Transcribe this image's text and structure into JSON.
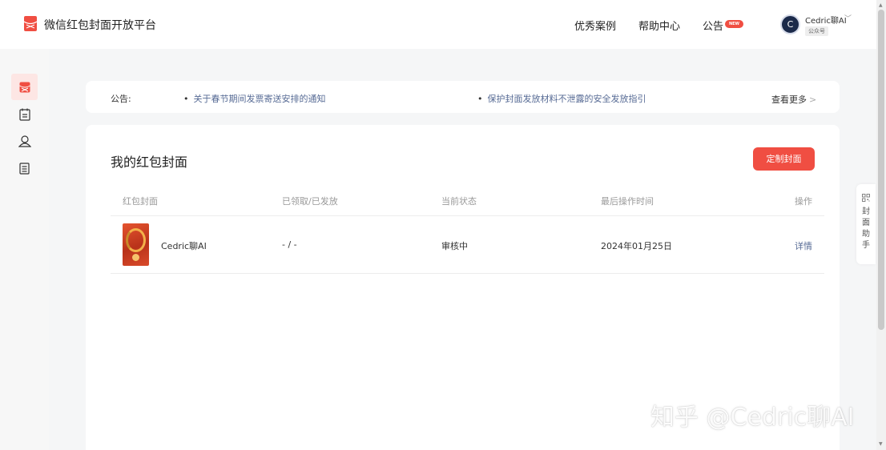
{
  "app": {
    "title": "微信红包封面开放平台"
  },
  "topnav": {
    "items": [
      {
        "label": "优秀案例"
      },
      {
        "label": "帮助中心"
      },
      {
        "label": "公告"
      }
    ],
    "new_badge": "NEW"
  },
  "user": {
    "name": "Cedric聊AI",
    "avatar_letter": "C",
    "account_type": "公众号"
  },
  "sidebar": {
    "items": [
      {
        "icon": "red-packet-icon",
        "active": true
      },
      {
        "icon": "clipboard-icon",
        "active": false
      },
      {
        "icon": "user-icon",
        "active": false
      },
      {
        "icon": "document-icon",
        "active": false
      }
    ]
  },
  "notice": {
    "label": "公告:",
    "links": [
      "关于春节期间发票寄送安排的通知",
      "保护封面发放材料不泄露的安全发放指引"
    ],
    "more": "查看更多"
  },
  "covers": {
    "title": "我的红包封面",
    "create_button": "定制封面",
    "columns": [
      "红包封面",
      "已领取/已发放",
      "当前状态",
      "最后操作时间",
      "操作"
    ],
    "rows": [
      {
        "name": "Cedric聊AI",
        "claimed_issued": "- / -",
        "status": "审核中",
        "updated": "2024年01月25日",
        "action": "详情"
      }
    ]
  },
  "helper": {
    "label": "封面助手",
    "chars": [
      "封",
      "面",
      "助",
      "手"
    ]
  },
  "watermark": "知乎 @Cedric聊AI",
  "colors": {
    "accent": "#f04e42",
    "link": "#576b95"
  }
}
